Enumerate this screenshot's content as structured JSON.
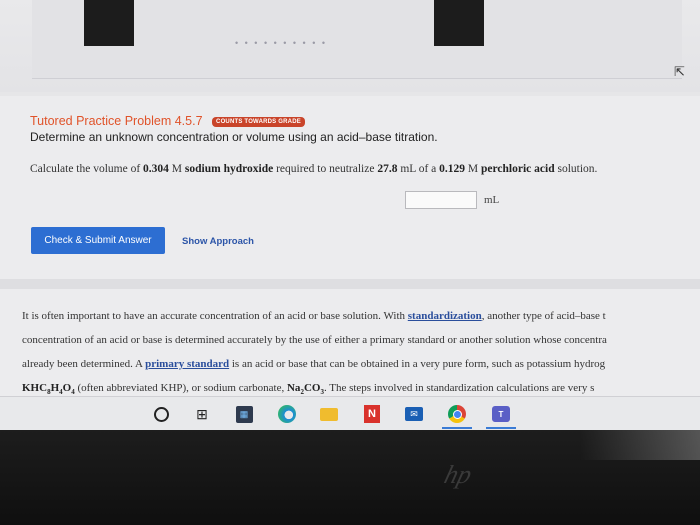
{
  "problem": {
    "title": "Tutored Practice Problem 4.5.7",
    "badge": "COUNTS TOWARDS GRADE",
    "subtitle": "Determine an unknown concentration or volume using an acid–base titration."
  },
  "question": {
    "p1": "Calculate the volume of ",
    "b1": "0.304",
    "p2": " M ",
    "b2": "sodium hydroxide",
    "p3": " required to neutralize ",
    "b3": "27.8",
    "p4": " mL of a ",
    "b4": "0.129",
    "p5": " M ",
    "b5": "perchloric acid",
    "p6": " solution."
  },
  "answer": {
    "value": "",
    "unit": "mL"
  },
  "buttons": {
    "submit": "Check & Submit Answer",
    "approach": "Show Approach"
  },
  "paragraph": {
    "l1a": "It is often important to have an accurate concentration of an acid or base solution. With ",
    "l1term": "standardization",
    "l1b": ", another type of acid–base t",
    "l2": "concentration of an acid or base is determined accurately by the use of either a primary standard or another solution whose concentra",
    "l3a": "already been determined. A ",
    "l3term": "primary standard",
    "l3b": " is an acid or base that can be obtained in a very pure form, such as potassium hydrog",
    "l4_khp_k": "KHC",
    "l4_khp_s1": "8",
    "l4_khp_h": "H",
    "l4_khp_s2": "4",
    "l4_khp_o": "O",
    "l4_khp_s3": "4",
    "l4_mid": " (often abbreviated KHP), or sodium carbonate, ",
    "l4_na": "Na",
    "l4_na_s": "2",
    "l4_co": "CO",
    "l4_co_s": "3",
    "l4_end": ". The steps involved in standardization calculations are very s"
  },
  "screen_top": {
    "dots": "• • • • • • •   • • •"
  },
  "taskbar": {
    "icons": [
      "search-icon",
      "task-view-icon",
      "calculator-icon",
      "edge-icon",
      "file-explorer-icon",
      "onenote-icon",
      "mail-icon",
      "chrome-icon",
      "teams-icon"
    ],
    "n_label": "N"
  },
  "bezel": {
    "logo": "hp"
  },
  "colors": {
    "title": "#e0532a",
    "badge": "#c9442a",
    "submit": "#2d6ed2",
    "link": "#2c55a8"
  }
}
